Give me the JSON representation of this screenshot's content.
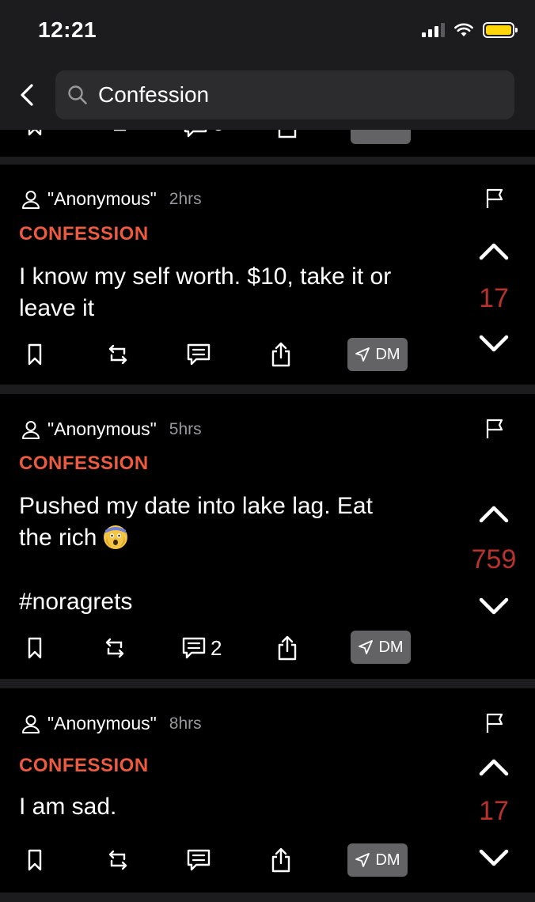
{
  "status_bar": {
    "time": "12:21"
  },
  "search": {
    "query": "Confession"
  },
  "posts": [
    {
      "author": "\"Anonymous\"",
      "time": "2hrs",
      "category": "CONFESSION",
      "text_line1": "I know my self worth. $10, take it or",
      "text_line2": "leave it",
      "score": "17",
      "comments": "",
      "dm_label": "DM"
    },
    {
      "author": "\"Anonymous\"",
      "time": "5hrs",
      "category": "CONFESSION",
      "text_line1": "Pushed my date into lake lag. Eat",
      "text_line2": "the rich",
      "hashtag": "#noragrets",
      "score": "759",
      "comments": "2",
      "dm_label": "DM"
    },
    {
      "author": "\"Anonymous\"",
      "time": "8hrs",
      "category": "CONFESSION",
      "text_line1": "I am sad.",
      "score": "17",
      "comments": "",
      "dm_label": "DM"
    }
  ],
  "colors": {
    "accent": "#ec5b3f",
    "score": "#b7322e",
    "dm_button": "#636366",
    "background": "#000000"
  },
  "icons": [
    "back-icon",
    "search-icon",
    "user-icon",
    "flag-icon",
    "chevron-up-icon",
    "chevron-down-icon",
    "bookmark-icon",
    "repost-icon",
    "comment-icon",
    "share-icon",
    "send-icon",
    "fearful-face-emoji"
  ]
}
